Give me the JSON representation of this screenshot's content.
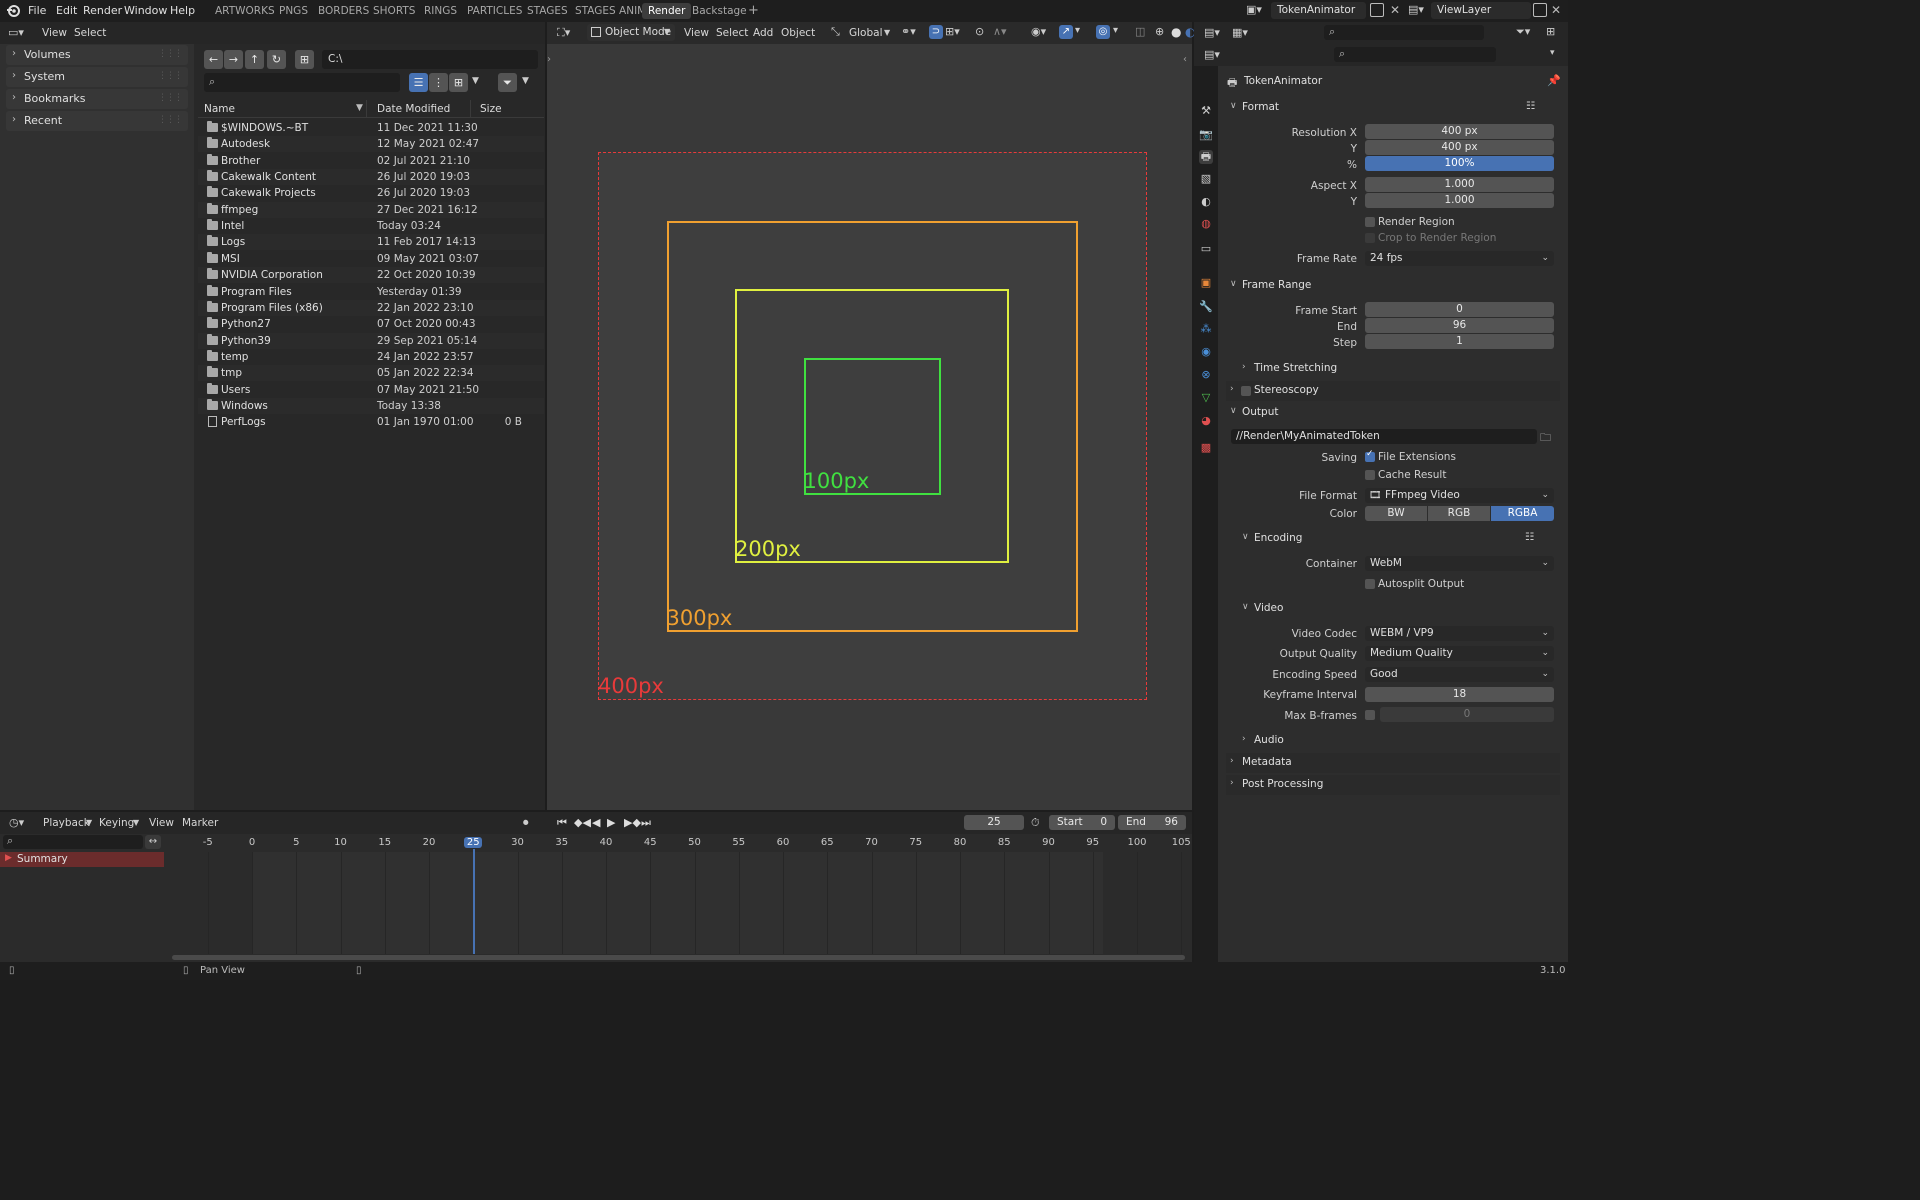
{
  "menu": {
    "file": "File",
    "edit": "Edit",
    "render": "Render",
    "window": "Window",
    "help": "Help"
  },
  "workspaces": [
    "ARTWORKS",
    "PNGS",
    "BORDERS",
    "SHORTS",
    "RINGS",
    "PARTICLES",
    "STAGES",
    "STAGES ANIM",
    "Render",
    "Backstage"
  ],
  "workspace_add": "+",
  "scene": "TokenAnimator",
  "view_layer": "ViewLayer",
  "filebrowser": {
    "view": "View",
    "select": "Select",
    "path": "C:\\",
    "sidebar": [
      "Volumes",
      "System",
      "Bookmarks",
      "Recent"
    ],
    "columns": {
      "name": "Name",
      "date": "Date Modified",
      "size": "Size"
    },
    "files": [
      {
        "name": "$WINDOWS.~BT",
        "date": "11 Dec 2021 11:30",
        "size": ""
      },
      {
        "name": "Autodesk",
        "date": "12 May 2021 02:47",
        "size": ""
      },
      {
        "name": "Brother",
        "date": "02 Jul 2021 21:10",
        "size": ""
      },
      {
        "name": "Cakewalk Content",
        "date": "26 Jul 2020 19:03",
        "size": ""
      },
      {
        "name": "Cakewalk Projects",
        "date": "26 Jul 2020 19:03",
        "size": ""
      },
      {
        "name": "ffmpeg",
        "date": "27 Dec 2021 16:12",
        "size": ""
      },
      {
        "name": "Intel",
        "date": "Today 03:24",
        "size": ""
      },
      {
        "name": "Logs",
        "date": "11 Feb 2017 14:13",
        "size": ""
      },
      {
        "name": "MSI",
        "date": "09 May 2021 03:07",
        "size": ""
      },
      {
        "name": "NVIDIA Corporation",
        "date": "22 Oct 2020 10:39",
        "size": ""
      },
      {
        "name": "Program Files",
        "date": "Yesterday 01:39",
        "size": ""
      },
      {
        "name": "Program Files (x86)",
        "date": "22 Jan 2022 23:10",
        "size": ""
      },
      {
        "name": "Python27",
        "date": "07 Oct 2020 00:43",
        "size": ""
      },
      {
        "name": "Python39",
        "date": "29 Sep 2021 05:14",
        "size": ""
      },
      {
        "name": "temp",
        "date": "24 Jan 2022 23:57",
        "size": ""
      },
      {
        "name": "tmp",
        "date": "05 Jan 2022 22:34",
        "size": ""
      },
      {
        "name": "Users",
        "date": "07 May 2021 21:50",
        "size": ""
      },
      {
        "name": "Windows",
        "date": "Today 13:38",
        "size": ""
      },
      {
        "name": "PerfLogs",
        "date": "01 Jan 1970 01:00",
        "size": "0 B"
      }
    ]
  },
  "viewport": {
    "mode": "Object Mode",
    "view": "View",
    "select": "Select",
    "add": "Add",
    "object": "Object",
    "orientation": "Global",
    "squares": [
      {
        "label": "400px",
        "color": "#e83a3a"
      },
      {
        "label": "300px",
        "color": "#f0a030"
      },
      {
        "label": "200px",
        "color": "#e0f040"
      },
      {
        "label": "100px",
        "color": "#40e040"
      }
    ]
  },
  "properties": {
    "title": "TokenAnimator",
    "format": {
      "header": "Format",
      "resolution_x_label": "Resolution X",
      "resolution_x": "400 px",
      "resolution_y_label": "Y",
      "resolution_y": "400 px",
      "percent_label": "%",
      "percent": "100%",
      "aspect_x_label": "Aspect X",
      "aspect_x": "1.000",
      "aspect_y_label": "Y",
      "aspect_y": "1.000",
      "render_region": "Render Region",
      "crop": "Crop to Render Region",
      "frame_rate_label": "Frame Rate",
      "frame_rate": "24 fps"
    },
    "frame_range": {
      "header": "Frame Range",
      "start_label": "Frame Start",
      "start": "0",
      "end_label": "End",
      "end": "96",
      "step_label": "Step",
      "step": "1",
      "time_stretching": "Time Stretching"
    },
    "stereoscopy": "Stereoscopy",
    "output": {
      "header": "Output",
      "path": "//Render\\MyAnimatedToken",
      "saving_label": "Saving",
      "file_extensions": "File Extensions",
      "cache_result": "Cache Result",
      "file_format_label": "File Format",
      "file_format": "FFmpeg Video",
      "color_label": "Color",
      "color_bw": "BW",
      "color_rgb": "RGB",
      "color_rgba": "RGBA"
    },
    "encoding": {
      "header": "Encoding",
      "container_label": "Container",
      "container": "WebM",
      "autosplit": "Autosplit Output"
    },
    "video": {
      "header": "Video",
      "codec_label": "Video Codec",
      "codec": "WEBM / VP9",
      "quality_label": "Output Quality",
      "quality": "Medium Quality",
      "speed_label": "Encoding Speed",
      "speed": "Good",
      "keyframe_label": "Keyframe Interval",
      "keyframe": "18",
      "bframes_label": "Max B-frames",
      "bframes": "0"
    },
    "audio": "Audio",
    "metadata": "Metadata",
    "post_processing": "Post Processing"
  },
  "timeline": {
    "playback": "Playback",
    "keying": "Keying",
    "view": "View",
    "marker": "Marker",
    "current_frame": "25",
    "start_label": "Start",
    "start": "0",
    "end_label": "End",
    "end": "96",
    "summary": "Summary",
    "ticks": [
      "-5",
      "0",
      "5",
      "10",
      "15",
      "20",
      "25",
      "30",
      "35",
      "40",
      "45",
      "50",
      "55",
      "60",
      "65",
      "70",
      "75",
      "80",
      "85",
      "90",
      "95",
      "100",
      "105"
    ]
  },
  "statusbar": {
    "pan": "Pan View",
    "version": "3.1.0"
  },
  "colors": {
    "accent": "#4772b3",
    "playhead": "#4772b3",
    "summary": "#6b2c2c"
  }
}
